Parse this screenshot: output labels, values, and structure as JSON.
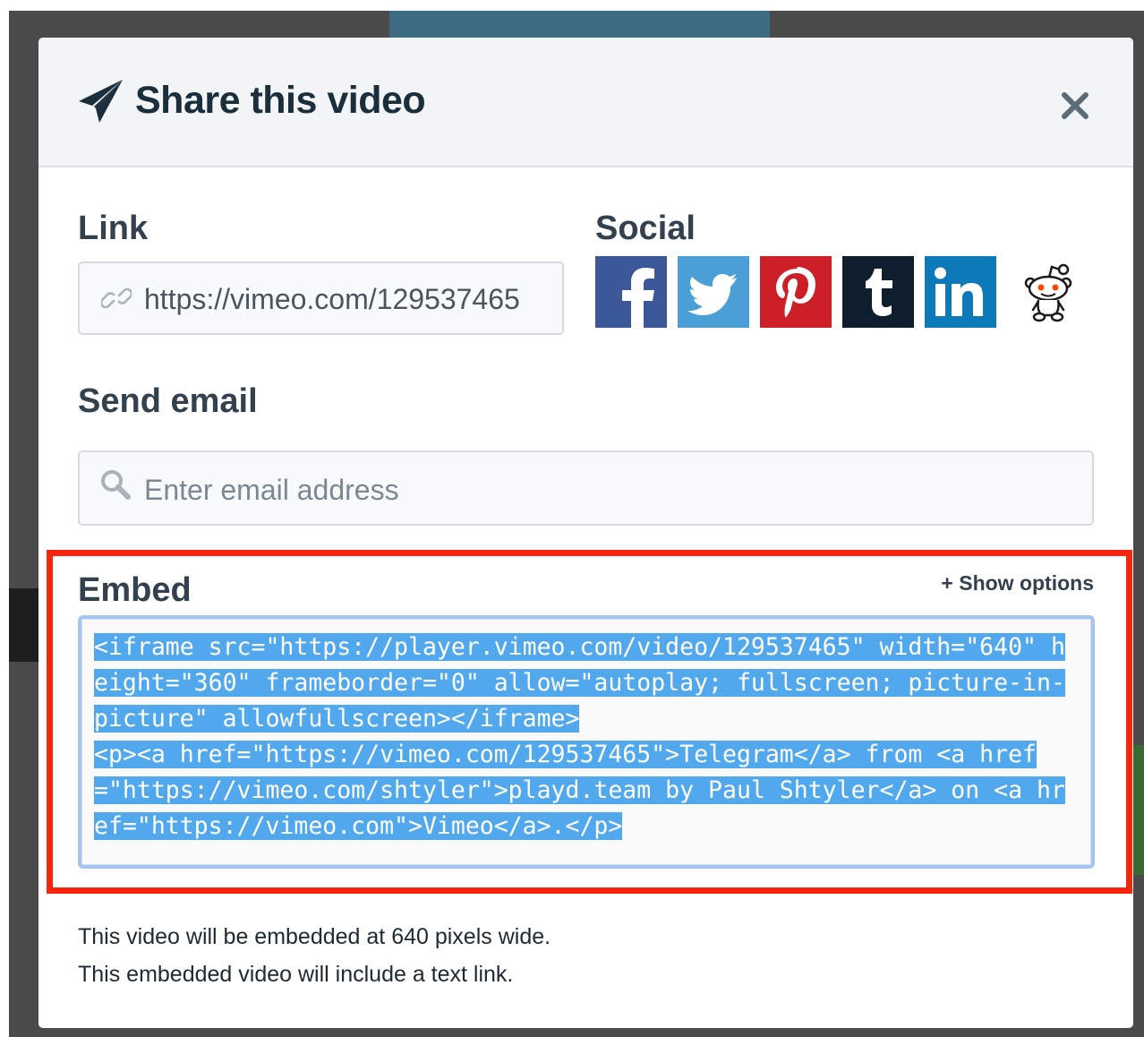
{
  "dialog": {
    "title": "Share this video",
    "close_icon": "close-icon",
    "title_icon": "paper-plane-icon"
  },
  "link": {
    "label": "Link",
    "value": "https://vimeo.com/129537465",
    "icon": "chain-link-icon"
  },
  "social": {
    "label": "Social",
    "buttons": [
      {
        "name": "facebook",
        "icon": "facebook-icon",
        "color": "#3b5998"
      },
      {
        "name": "twitter",
        "icon": "twitter-icon",
        "color": "#4a9fd6"
      },
      {
        "name": "pinterest",
        "icon": "pinterest-icon",
        "color": "#cc1f27"
      },
      {
        "name": "tumblr",
        "icon": "tumblr-icon",
        "color": "#0f1e2c"
      },
      {
        "name": "linkedin",
        "icon": "linkedin-icon",
        "color": "#0c7ab8"
      },
      {
        "name": "reddit",
        "icon": "reddit-icon",
        "color": "#ff4500"
      }
    ]
  },
  "email": {
    "label": "Send email",
    "placeholder": "Enter email address",
    "icon": "search-icon"
  },
  "embed": {
    "label": "Embed",
    "show_options": "+ Show options",
    "code": "<iframe src=\"https://player.vimeo.com/video/129537465\" width=\"640\" height=\"360\" frameborder=\"0\" allow=\"autoplay; fullscreen; picture-in-picture\" allowfullscreen></iframe>\n<p><a href=\"https://vimeo.com/129537465\">Telegram</a> from <a href=\"https://vimeo.com/shtyler\">playd.team by Paul Shtyler</a> on <a href=\"https://vimeo.com\">Vimeo</a>.</p>",
    "selected": true,
    "selection_color": "#51a8ec"
  },
  "info": {
    "line1": "This video will be embedded at 640 pixels wide.",
    "line2": "This embedded video will include a text link."
  },
  "colors": {
    "highlight": "#f7250d",
    "title": "#1a2e3b",
    "label": "#33414e"
  }
}
